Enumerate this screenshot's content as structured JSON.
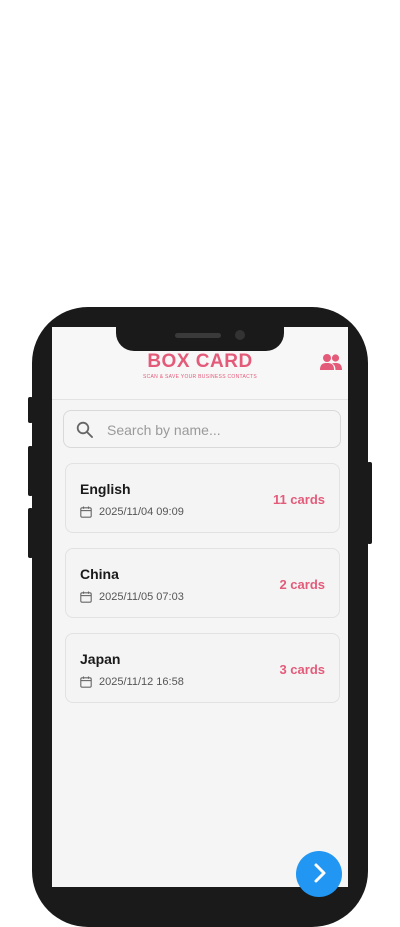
{
  "app": {
    "brand": "BOX CARD",
    "tagline": "SCAN & SAVE YOUR BUSINESS CONTACTS",
    "accent_color": "#e45b7a"
  },
  "header": {
    "users_icon": "users-icon"
  },
  "search": {
    "placeholder": "Search by name...",
    "icon": "search-icon"
  },
  "groups": [
    {
      "name": "English",
      "date": "2025/11/04 09:09",
      "count": "11 cards"
    },
    {
      "name": "China",
      "date": "2025/11/05 07:03",
      "count": "2 cards"
    },
    {
      "name": "Japan",
      "date": "2025/11/12 16:58",
      "count": "3 cards"
    }
  ],
  "fab": {
    "icon": "next-icon",
    "color": "#2196f3"
  }
}
